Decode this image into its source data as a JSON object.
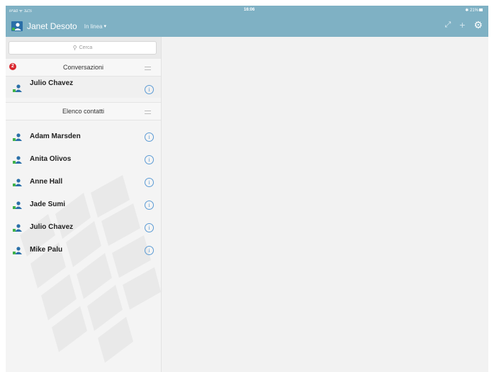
{
  "status": {
    "left": "iPad ᯤ 3ZS",
    "time": "16:06",
    "right": "✱ 21%"
  },
  "header": {
    "user_name": "Janet Desoto",
    "presence": "In linea",
    "caret": "▾"
  },
  "icons": {
    "expand": "⤢",
    "add": "+",
    "settings": "⚙"
  },
  "search": {
    "icon": "⚲",
    "placeholder": "Cerca"
  },
  "conversations": {
    "title": "Conversazioni",
    "badge": "2",
    "items": [
      {
        "name": "Julio Chavez"
      }
    ]
  },
  "contacts": {
    "title": "Elenco contatti",
    "items": [
      {
        "name": "Adam Marsden"
      },
      {
        "name": "Anita Olivos"
      },
      {
        "name": "Anne Hall"
      },
      {
        "name": "Jade Sumi"
      },
      {
        "name": "Julio Chavez"
      },
      {
        "name": "Mike Palu"
      }
    ]
  },
  "info_glyph": "i",
  "colors": {
    "header": "#7fb1c4",
    "badge": "#d9272e",
    "info": "#5b9bd5",
    "person": "#2a6fa8"
  }
}
